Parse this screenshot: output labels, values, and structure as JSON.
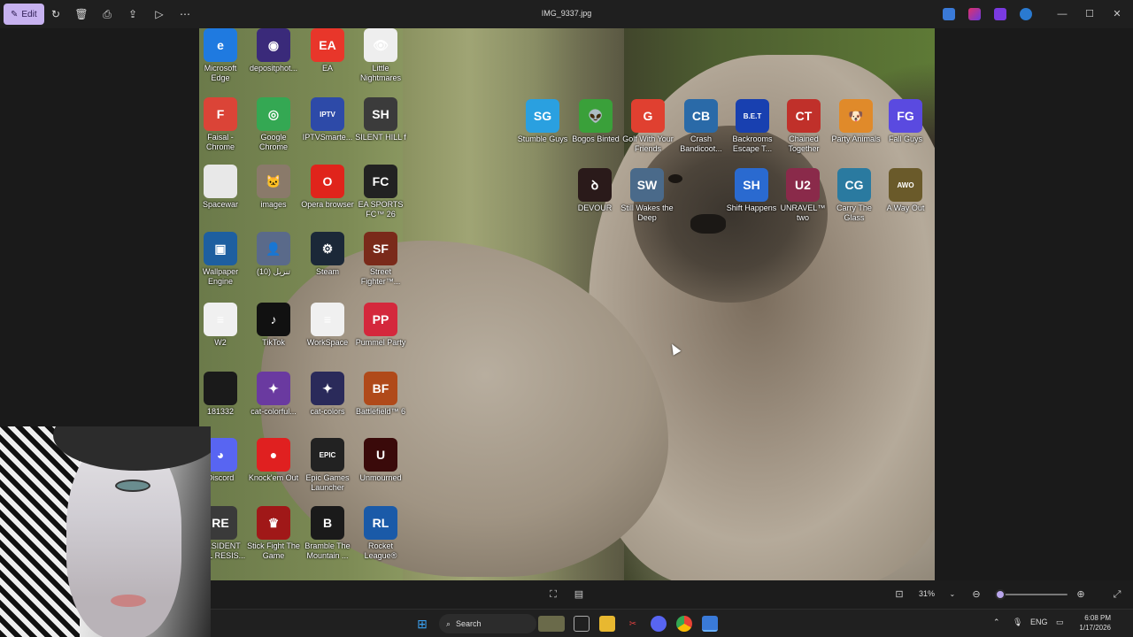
{
  "titlebar": {
    "edit_label": "Edit",
    "file_name": "IMG_9337.jpg",
    "icons": [
      "rotate-icon",
      "delete-icon",
      "print-icon",
      "share-icon",
      "slideshow-icon",
      "more-icon"
    ]
  },
  "desktop": {
    "icons": [
      {
        "label": "Microsoft Edge",
        "color": "#1f7ae0",
        "glyph": "e"
      },
      {
        "label": "depositphot...",
        "color": "#3a2a7a",
        "glyph": "◉"
      },
      {
        "label": "EA",
        "color": "#e8362a",
        "glyph": "EA"
      },
      {
        "label": "Little Nightmares",
        "color": "#eeeeee",
        "glyph": "👁"
      },
      {
        "label": "Faisal - Chrome",
        "color": "#db4437",
        "glyph": "F"
      },
      {
        "label": "Google Chrome",
        "color": "#34a853",
        "glyph": "◎"
      },
      {
        "label": "IPTVSmarte...",
        "color": "#2d4aa8",
        "glyph": "IPTV"
      },
      {
        "label": "SILENT HILL f",
        "color": "#3b3b3b",
        "glyph": "SH"
      },
      {
        "label": "Spacewar",
        "color": "#e8e8e8",
        "glyph": ""
      },
      {
        "label": "images",
        "color": "#8a7a6a",
        "glyph": "🐱"
      },
      {
        "label": "Opera browser",
        "color": "#e0241b",
        "glyph": "O"
      },
      {
        "label": "EA SPORTS FC™ 26",
        "color": "#222222",
        "glyph": "FC"
      },
      {
        "label": "Wallpaper Engine",
        "color": "#1e5fa0",
        "glyph": "▣"
      },
      {
        "label": "تنزيل (10)",
        "color": "#5a6a8a",
        "glyph": "👤"
      },
      {
        "label": "Steam",
        "color": "#1b2838",
        "glyph": "⚙"
      },
      {
        "label": "Street Fighter™...",
        "color": "#7a2a1a",
        "glyph": "SF"
      },
      {
        "label": "W2",
        "color": "#f0f0f0",
        "glyph": "≡"
      },
      {
        "label": "TikTok",
        "color": "#111111",
        "glyph": "♪"
      },
      {
        "label": "WorkSpace",
        "color": "#f0f0f0",
        "glyph": "≡"
      },
      {
        "label": "Pummel Party",
        "color": "#d4283c",
        "glyph": "PP"
      },
      {
        "label": "181332",
        "color": "#1a1a1a",
        "glyph": ""
      },
      {
        "label": "cat-colorful...",
        "color": "#6a3aa0",
        "glyph": "✦"
      },
      {
        "label": "cat-colors",
        "color": "#2a2a5a",
        "glyph": "✦"
      },
      {
        "label": "Battlefield™ 6",
        "color": "#b04a1a",
        "glyph": "BF"
      },
      {
        "label": "Discord",
        "color": "#5865f2",
        "glyph": "◕"
      },
      {
        "label": "Knock'em Out",
        "color": "#e02020",
        "glyph": "●"
      },
      {
        "label": "Epic Games Launcher",
        "color": "#222222",
        "glyph": "EPIC"
      },
      {
        "label": "Unmourned",
        "color": "#3a0a0a",
        "glyph": "U"
      },
      {
        "label": "RESIDENT EVIL RESIS...",
        "color": "#3a3a3a",
        "glyph": "RE"
      },
      {
        "label": "Stick Fight The Game",
        "color": "#a01818",
        "glyph": "♛"
      },
      {
        "label": "Bramble The Mountain ...",
        "color": "#1a1a1a",
        "glyph": "B"
      },
      {
        "label": "Rocket League®",
        "color": "#1a5aa8",
        "glyph": "RL"
      },
      {
        "label": "Stumble Guys",
        "color": "#2aa0e0",
        "glyph": "SG"
      },
      {
        "label": "Bogos Binted",
        "color": "#3aa03a",
        "glyph": "👽"
      },
      {
        "label": "Golf With Your Friends",
        "color": "#e04030",
        "glyph": "G"
      },
      {
        "label": "Crash Bandicoot...",
        "color": "#2a6aa8",
        "glyph": "CB"
      },
      {
        "label": "Backrooms Escape T...",
        "color": "#1840b0",
        "glyph": "B.E.T"
      },
      {
        "label": "Chained Together",
        "color": "#c0302a",
        "glyph": "CT"
      },
      {
        "label": "Party Animals",
        "color": "#e08a2a",
        "glyph": "🐶"
      },
      {
        "label": "Fall Guys",
        "color": "#5a4ae0",
        "glyph": "FG"
      },
      {
        "label": "DEVOUR",
        "color": "#2a1a1a",
        "glyph": "ꝺ"
      },
      {
        "label": "Still Wakes the Deep",
        "color": "#4a6a8a",
        "glyph": "SW"
      },
      {
        "label": "Shift Happens",
        "color": "#2a6ad0",
        "glyph": "SH"
      },
      {
        "label": "UNRAVEL™ two",
        "color": "#8a2a4a",
        "glyph": "U2"
      },
      {
        "label": "Carry The Glass",
        "color": "#2a7aa0",
        "glyph": "CG"
      },
      {
        "label": "A Way Out",
        "color": "#6a5a2a",
        "glyph": "AWO"
      }
    ]
  },
  "bottombar": {
    "zoom_label": "31%",
    "zoom_fraction": 0.05
  },
  "taskbar": {
    "search_placeholder": "Search",
    "lang": "ENG",
    "time": "6:08 PM",
    "date": "1/17/2026"
  }
}
